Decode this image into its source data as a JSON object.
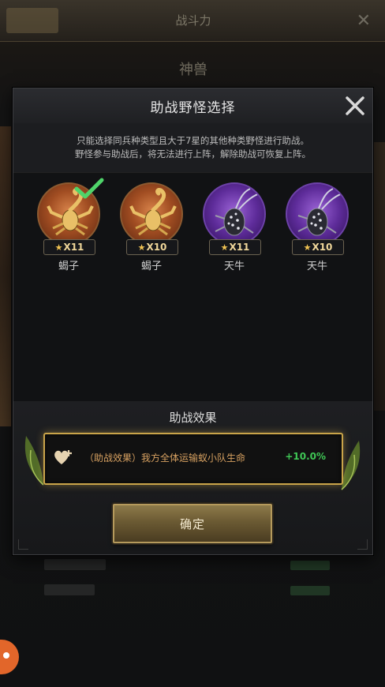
{
  "background": {
    "title": "战斗力",
    "subtitle": "神兽"
  },
  "dialog": {
    "title": "助战野怪选择",
    "description_line1": "只能选择同兵种类型且大于7星的其他种类野怪进行助战。",
    "description_line2": "野怪参与助战后，将无法进行上阵，解除助战可恢复上阵。",
    "monsters": [
      {
        "name": "蝎子",
        "stars": "X11",
        "theme": "orange",
        "selected": true
      },
      {
        "name": "蝎子",
        "stars": "X10",
        "theme": "orange",
        "selected": false
      },
      {
        "name": "天牛",
        "stars": "X11",
        "theme": "purple",
        "selected": false
      },
      {
        "name": "天牛",
        "stars": "X10",
        "theme": "purple",
        "selected": false
      }
    ],
    "effect_section_title": "助战效果",
    "effect_text": "（助战效果）我方全体运输蚁小队生命",
    "effect_value": "+10.0%",
    "confirm_label": "确定"
  },
  "colors": {
    "gold_border": "#c9a44a",
    "positive_green": "#3fc655",
    "effect_text": "#d7a161",
    "check_green": "#4fd46a"
  }
}
